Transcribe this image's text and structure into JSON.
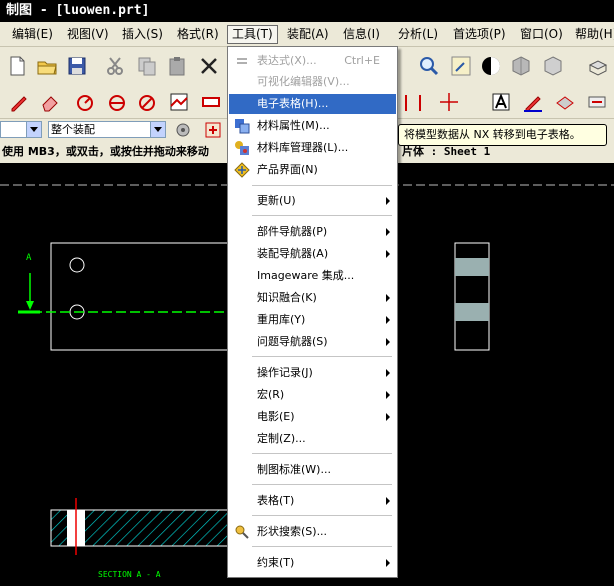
{
  "window": {
    "title": "制图 - [luowen.prt]"
  },
  "menubar": {
    "items": [
      {
        "label": "编辑(E)"
      },
      {
        "label": "视图(V)"
      },
      {
        "label": "插入(S)"
      },
      {
        "label": "格式(R)"
      },
      {
        "label": "工具(T)"
      },
      {
        "label": "装配(A)"
      },
      {
        "label": "信息(I)"
      },
      {
        "label": "分析(L)"
      },
      {
        "label": "首选项(P)"
      },
      {
        "label": "窗口(O)"
      },
      {
        "label": "帮助(H)"
      }
    ]
  },
  "selection_bar": {
    "combo2_value": "整个装配"
  },
  "status": {
    "prompt": "使用 MB3，或双击，或按住并拖动来移动",
    "sheet": "片体 : Sheet 1"
  },
  "tools_menu": {
    "items": [
      {
        "label": "表达式(X)...",
        "shortcut": "Ctrl+E",
        "icon": "expression-icon"
      },
      {
        "label": "可视化编辑器(V)...",
        "icon": ""
      },
      {
        "label": "电子表格(H)...",
        "icon": ""
      },
      {
        "label": "材料属性(M)...",
        "icon": "material-icon"
      },
      {
        "label": "材料库管理器(L)...",
        "icon": "material-library-icon"
      },
      {
        "label": "产品界面(N)",
        "icon": "product-interface-icon"
      },
      {
        "label": "更新(U)"
      },
      {
        "label": "部件导航器(P)"
      },
      {
        "label": "装配导航器(A)"
      },
      {
        "label": "Imageware 集成..."
      },
      {
        "label": "知识融合(K)"
      },
      {
        "label": "重用库(Y)"
      },
      {
        "label": "问题导航器(S)"
      },
      {
        "label": "操作记录(J)"
      },
      {
        "label": "宏(R)"
      },
      {
        "label": "电影(E)"
      },
      {
        "label": "定制(Z)..."
      },
      {
        "label": "制图标准(W)..."
      },
      {
        "label": "表格(T)"
      },
      {
        "label": "形状搜索(S)...",
        "icon": "shape-search-icon"
      },
      {
        "label": "约束(T)"
      }
    ]
  },
  "tooltip": {
    "text": "将模型数据从 NX 转移到电子表格。"
  },
  "drawing": {
    "label_a": "A",
    "section_label": "SECTION A - A"
  },
  "colors": {
    "highlight": "#316ac5",
    "centerline": "#00ff00",
    "hatch": "#00d0d0",
    "drawing_bg": "#000000"
  }
}
